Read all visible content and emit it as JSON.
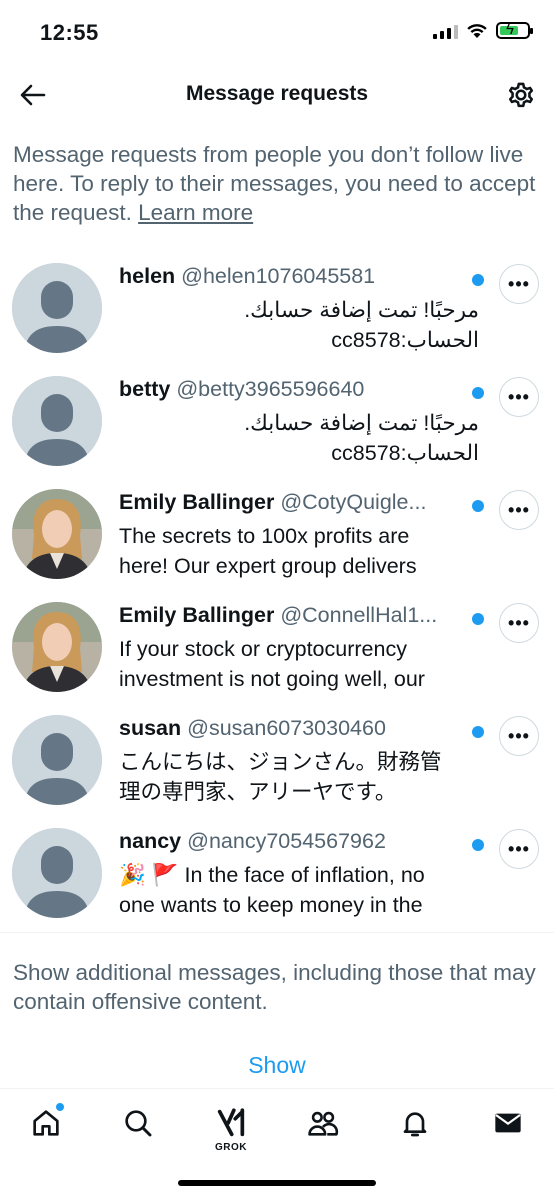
{
  "status_bar": {
    "time": "12:55"
  },
  "header": {
    "title": "Message requests"
  },
  "intro": {
    "text": "Message requests from people you don’t follow live here. To reply to their messages, you need to accept the request.",
    "link": "Learn more"
  },
  "messages": [
    {
      "name": "helen",
      "handle": "@helen1076045581",
      "line1": "مرحبًا! تمت إضافة حسابك.",
      "line2": "الحساب:cc8578",
      "avatar": "default",
      "unread": true
    },
    {
      "name": "betty",
      "handle": "@betty3965596640",
      "line1": "مرحبًا! تمت إضافة حسابك.",
      "line2": "الحساب:cc8578",
      "avatar": "default",
      "unread": true
    },
    {
      "name": "Emily Ballinger",
      "handle": "@CotyQuigle...",
      "line1": "The secrets to 100x profits are",
      "line2": "here! Our expert group delivers",
      "avatar": "photo",
      "unread": true
    },
    {
      "name": "Emily Ballinger",
      "handle": "@ConnellHal1...",
      "line1": "If your stock or cryptocurrency",
      "line2": "investment is not going well, our",
      "avatar": "photo",
      "unread": true
    },
    {
      "name": "susan",
      "handle": "@susan6073030460",
      "line1": "こんにちは、ジョンさん。財務管",
      "line2": "理の専門家、アリーヤです。",
      "avatar": "default",
      "unread": true
    },
    {
      "name": "nancy",
      "handle": "@nancy7054567962",
      "line1": "🎉 🚩 In the face of inflation, no",
      "line2": "one wants to keep money in the",
      "avatar": "default",
      "unread": true
    }
  ],
  "more_label": "•••",
  "additional": {
    "text": "Show additional messages, including those that may contain offensive content.",
    "button": "Show"
  },
  "tabbar": {
    "grok_label": "GROK"
  },
  "colors": {
    "accent": "#1d9bf0",
    "secondary_text": "#536471",
    "avatar_bg": "#ccd6dd",
    "avatar_fg": "#657786"
  },
  "icons": [
    "back-arrow-icon",
    "gear-icon",
    "more-icon",
    "home-icon",
    "search-icon",
    "grok-icon",
    "communities-icon",
    "bell-icon",
    "mail-icon"
  ]
}
